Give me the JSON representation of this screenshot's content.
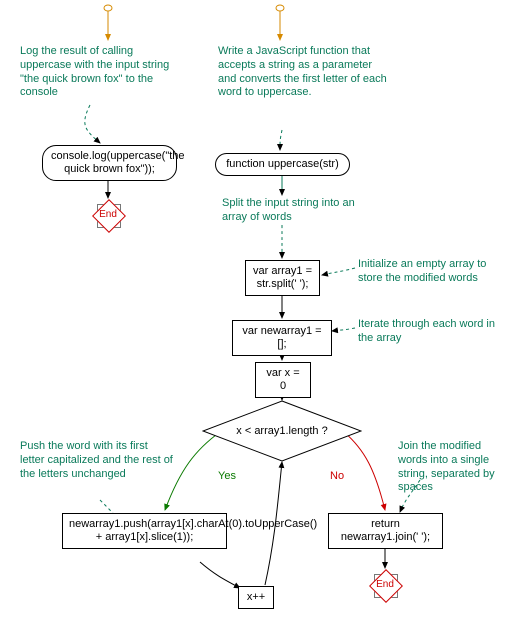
{
  "annotations": {
    "left_top": "Log the result of calling uppercase with the input string \"the quick brown fox\" to the console",
    "right_top": "Write a JavaScript function that accepts a string as a parameter and converts the first letter of each word to uppercase.",
    "split": "Split the input string into an array of words",
    "init_array": "Initialize an empty array to store the modified words",
    "iterate": "Iterate through each word in the array",
    "push_word": "Push the word with its first letter capitalized and the rest of the letters unchanged",
    "join": "Join the modified words into a single string, separated by spaces"
  },
  "nodes": {
    "console_log": "console.log(uppercase(\"the quick brown fox\"));",
    "func_decl": "function uppercase(str)",
    "split_stmt": "var array1 = str.split(' ');",
    "newarray_stmt": "var newarray1 = [];",
    "varx_stmt": "var x = 0",
    "decision": "x < array1.length ?",
    "push_stmt": "newarray1.push(array1[x].charAt(0).toUpperCase() + array1[x].slice(1));",
    "incr_stmt": "x++",
    "return_stmt": "return newarray1.join(' ');",
    "end": "End"
  },
  "edges": {
    "yes": "Yes",
    "no": "No"
  }
}
